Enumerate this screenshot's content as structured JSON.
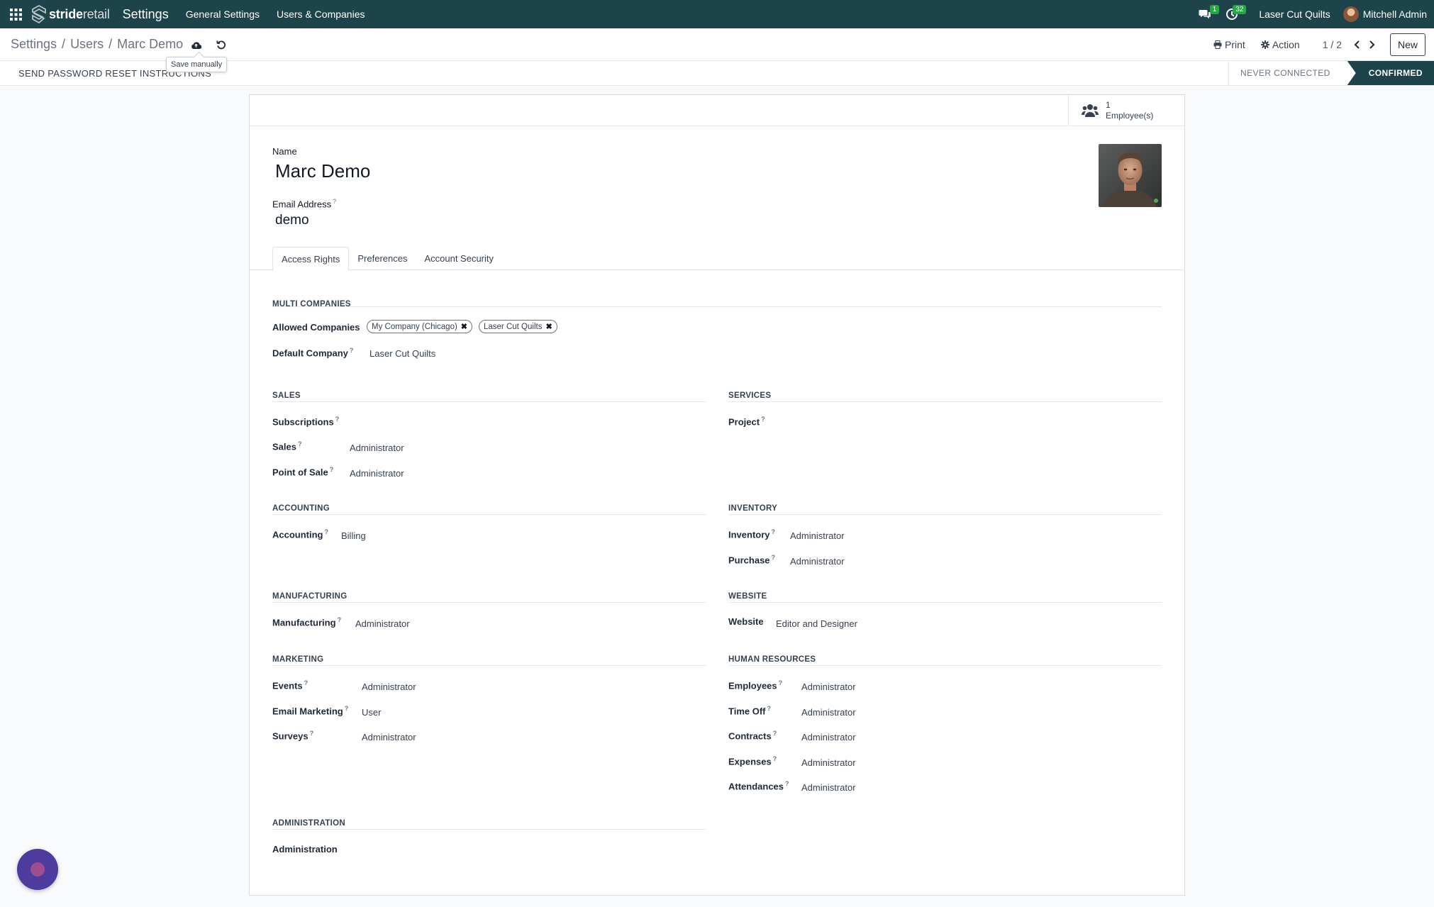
{
  "navbar": {
    "brand_bold": "stride",
    "brand_light": "retail",
    "app_title": "Settings",
    "menus": [
      "General Settings",
      "Users & Companies"
    ],
    "messages_badge": "1",
    "activities_badge": "32",
    "company": "Laser Cut Quilts",
    "user": "Mitchell Admin"
  },
  "control": {
    "breadcrumb": [
      "Settings",
      "Users",
      "Marc Demo"
    ],
    "tooltip": "Save manually",
    "print_label": "Print",
    "action_label": "Action",
    "pager": "1 / 2",
    "new_label": "New"
  },
  "statusbar": {
    "reset_label": "SEND PASSWORD RESET INSTRUCTIONS",
    "stage_never": "NEVER CONNECTED",
    "stage_confirmed": "CONFIRMED"
  },
  "sheet": {
    "employees_count": "1",
    "employees_label": "Employee(s)",
    "name_label": "Name",
    "name_value": "Marc Demo",
    "email_label": "Email Address",
    "email_value": "demo",
    "tabs": [
      "Access Rights",
      "Preferences",
      "Account Security"
    ]
  },
  "multi_companies": {
    "title": "MULTI COMPANIES",
    "allowed_label": "Allowed Companies",
    "allowed_tags": [
      "My Company (Chicago)",
      "Laser Cut Quilts"
    ],
    "default_label": "Default Company",
    "default_value": "Laser Cut Quilts"
  },
  "groups": {
    "sales": {
      "title": "SALES",
      "fields": [
        {
          "label": "Subscriptions",
          "value": ""
        },
        {
          "label": "Sales",
          "value": "Administrator"
        },
        {
          "label": "Point of Sale",
          "value": "Administrator"
        }
      ]
    },
    "services": {
      "title": "SERVICES",
      "fields": [
        {
          "label": "Project",
          "value": ""
        }
      ]
    },
    "accounting": {
      "title": "ACCOUNTING",
      "fields": [
        {
          "label": "Accounting",
          "value": "Billing"
        }
      ]
    },
    "inventory": {
      "title": "INVENTORY",
      "fields": [
        {
          "label": "Inventory",
          "value": "Administrator"
        },
        {
          "label": "Purchase",
          "value": "Administrator"
        }
      ]
    },
    "manufacturing": {
      "title": "MANUFACTURING",
      "fields": [
        {
          "label": "Manufacturing",
          "value": "Administrator"
        }
      ]
    },
    "website": {
      "title": "WEBSITE",
      "fields": [
        {
          "label": "Website",
          "value": "Editor and Designer"
        }
      ]
    },
    "marketing": {
      "title": "MARKETING",
      "fields": [
        {
          "label": "Events",
          "value": "Administrator"
        },
        {
          "label": "Email Marketing",
          "value": "User"
        },
        {
          "label": "Surveys",
          "value": "Administrator"
        }
      ]
    },
    "hr": {
      "title": "HUMAN RESOURCES",
      "fields": [
        {
          "label": "Employees",
          "value": "Administrator"
        },
        {
          "label": "Time Off",
          "value": "Administrator"
        },
        {
          "label": "Contracts",
          "value": "Administrator"
        },
        {
          "label": "Expenses",
          "value": "Administrator"
        },
        {
          "label": "Attendances",
          "value": "Administrator"
        }
      ]
    },
    "administration": {
      "title": "ADMINISTRATION",
      "fields": [
        {
          "label": "Administration",
          "value": ""
        }
      ]
    }
  },
  "colors": {
    "navbar": "#1c444a",
    "confirmed_stage": "#1c444a",
    "badge": "#28a745",
    "chat_bubble": "#4d3b9e"
  }
}
